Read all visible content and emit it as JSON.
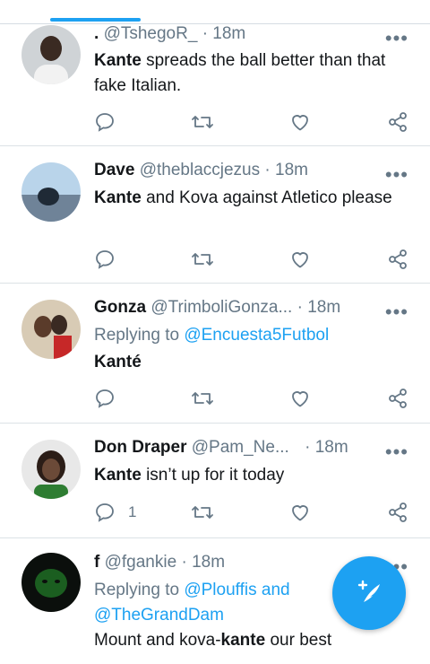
{
  "tweets": [
    {
      "name": ".",
      "handle": "@TshegoR_",
      "sep": "·",
      "time": "18m",
      "text_bold": "Kante",
      "text_rest": " spreads the ball better than that fake Italian.",
      "reply_count": ""
    },
    {
      "name": "Dave",
      "handle": "@theblaccjezus",
      "sep": "·",
      "time": "18m",
      "text_bold": "Kante",
      "text_rest": " and Kova against Atletico please",
      "reply_count": ""
    },
    {
      "name": "Gonza",
      "handle": "@TrimboliGonza...",
      "sep": "·",
      "time": "18m",
      "replying_prefix": "Replying to",
      "replying_to": "@Encuesta5Futbol",
      "text_bold": "Kanté",
      "text_rest": "",
      "reply_count": ""
    },
    {
      "name": "Don Draper",
      "handle": "@Pam_Ne...",
      "sep": "·",
      "time": "18m",
      "text_bold": "Kante",
      "text_rest": " isn’t up for it today",
      "reply_count": "1"
    },
    {
      "name": "f",
      "handle": "@fgankie",
      "sep": "·",
      "time": "18m",
      "replying_prefix": "Replying to",
      "replying_to": "@Plouffis and @TheGrandDam",
      "text_pre": "Mount and kova-",
      "text_bold": "kante",
      "text_rest": " our best",
      "reply_count": ""
    }
  ],
  "icons": {
    "more": "more-horizontal-icon",
    "reply": "reply-icon",
    "retweet": "retweet-icon",
    "like": "like-icon",
    "share": "share-icon",
    "compose": "compose-tweet-icon"
  },
  "colors": {
    "accent": "#1da1f2",
    "secondary_text": "#657786",
    "primary_text": "#14171a"
  }
}
